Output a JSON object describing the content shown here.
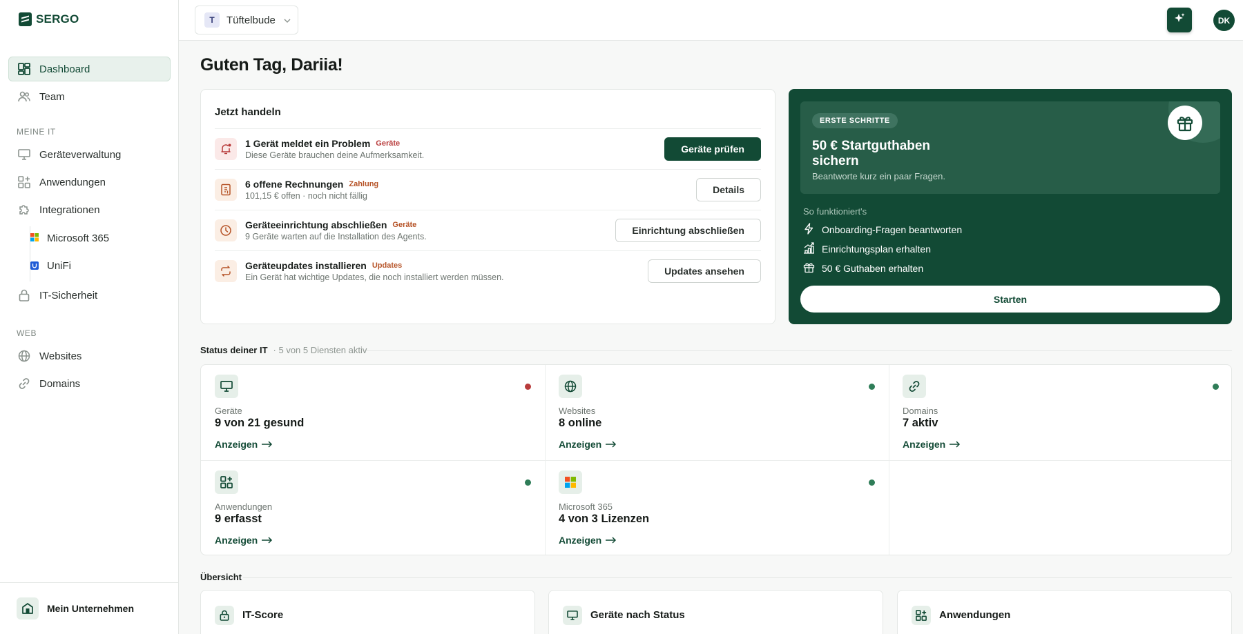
{
  "brand": {
    "name": "SERGO"
  },
  "sidebar": {
    "top_items": [
      {
        "label": "Dashboard",
        "icon": "dashboard-icon",
        "active": true
      },
      {
        "label": "Team",
        "icon": "team-icon"
      }
    ],
    "section_it": "MEINE IT",
    "it_items": [
      {
        "label": "Geräteverwaltung",
        "icon": "monitor-icon"
      },
      {
        "label": "Anwendungen",
        "icon": "apps-icon"
      },
      {
        "label": "Integrationen",
        "icon": "puzzle-icon"
      }
    ],
    "integrations": [
      {
        "label": "Microsoft 365",
        "icon": "microsoft-logo-icon"
      },
      {
        "label": "UniFi",
        "icon": "unifi-logo-icon"
      }
    ],
    "security_item": {
      "label": "IT-Sicherheit",
      "icon": "lock-icon"
    },
    "section_web": "WEB",
    "web_items": [
      {
        "label": "Websites",
        "icon": "globe-icon"
      },
      {
        "label": "Domains",
        "icon": "link-icon"
      }
    ],
    "footer": {
      "label": "Mein Unternehmen"
    }
  },
  "topbar": {
    "tenant_initial": "T",
    "tenant_name": "Tüftelbude",
    "avatar_initials": "DK"
  },
  "greeting": "Guten Tag, Dariia!",
  "actions": {
    "title": "Jetzt handeln",
    "rows": [
      {
        "title": "1 Gerät meldet ein Problem",
        "tag": "Geräte",
        "subtitle": "Diese Geräte brauchen deine Aufmerksamkeit.",
        "button": "Geräte prüfen",
        "icon": "bell-alert-icon"
      },
      {
        "title": "6 offene Rechnungen",
        "tag": "Zahlung",
        "subtitle": "101,15 € offen · noch nicht fällig",
        "button": "Details",
        "icon": "invoice-icon"
      },
      {
        "title": "Geräteeinrichtung abschließen",
        "tag": "Geräte",
        "subtitle": "9 Geräte warten auf die Installation des Agents.",
        "button": "Einrichtung abschließen",
        "icon": "clock-icon"
      },
      {
        "title": "Geräteupdates installieren",
        "tag": "Updates",
        "subtitle": "Ein Gerät hat wichtige Updates, die noch installiert werden müssen.",
        "button": "Updates ansehen",
        "icon": "refresh-icon"
      }
    ]
  },
  "promo": {
    "badge": "ERSTE SCHRITTE",
    "title": "50 € Startguthaben sichern",
    "subtitle": "Beantworte kurz ein paar Fragen.",
    "how_label": "So funktioniert's",
    "steps": [
      {
        "label": "Onboarding-Fragen beantworten",
        "icon": "bolt-icon"
      },
      {
        "label": "Einrichtungsplan erhalten",
        "icon": "chart-up-icon"
      },
      {
        "label": "50 € Guthaben erhalten",
        "icon": "gift-icon"
      }
    ],
    "button": "Starten"
  },
  "status": {
    "title": "Status deiner IT",
    "meta": "· 5 von 5 Diensten aktiv",
    "tiles": [
      {
        "label": "Geräte",
        "value": "9 von 21 gesund",
        "link": "Anzeigen",
        "dot": "#b83b3b",
        "icon": "monitor-icon"
      },
      {
        "label": "Websites",
        "value": "8 online",
        "link": "Anzeigen",
        "dot": "#2f7d58",
        "icon": "globe-icon"
      },
      {
        "label": "Domains",
        "value": "7 aktiv",
        "link": "Anzeigen",
        "dot": "#2f7d58",
        "icon": "link-icon"
      },
      {
        "label": "Anwendungen",
        "value": "9 erfasst",
        "link": "Anzeigen",
        "dot": "#2f7d58",
        "icon": "apps-icon"
      },
      {
        "label": "Microsoft 365",
        "value": "4 von 3 Lizenzen",
        "link": "Anzeigen",
        "dot": "#2f7d58",
        "icon": "microsoft-logo-icon"
      }
    ]
  },
  "overview": {
    "title": "Übersicht",
    "cards": [
      {
        "title": "IT-Score",
        "icon": "lock-icon"
      },
      {
        "title": "Geräte nach Status",
        "icon": "monitor-icon"
      },
      {
        "title": "Anwendungen",
        "icon": "apps-icon"
      }
    ]
  }
}
